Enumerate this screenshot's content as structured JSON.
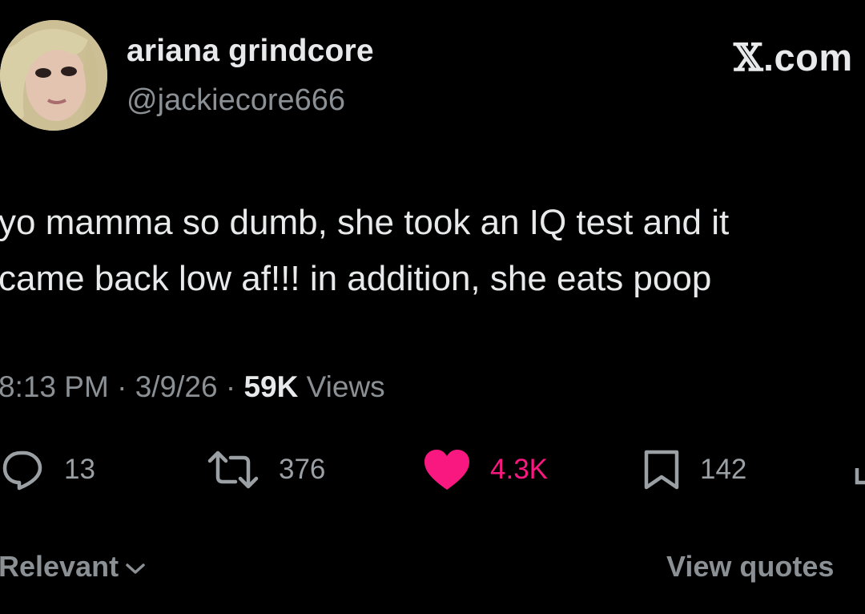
{
  "author": {
    "display_name": "ariana grindcore",
    "handle": "@jackiecore666"
  },
  "brand": {
    "logo_text": ".com",
    "logo_glyph": "𝕏"
  },
  "tweet": {
    "line1": "yo mamma so dumb, she took an IQ test and it",
    "line2": "came back low af!!! in addition, she eats poop"
  },
  "meta": {
    "time": "8:13 PM",
    "sep1": " · ",
    "date": "3/9/26",
    "sep2": " · ",
    "views_count": "59K",
    "views_label": " Views"
  },
  "actions": {
    "replies": {
      "icon": "reply-icon",
      "count": "13"
    },
    "reposts": {
      "icon": "repost-icon",
      "count": "376"
    },
    "likes": {
      "icon": "heart-icon",
      "count": "4.3K",
      "color": "#f91880"
    },
    "bookmarks": {
      "icon": "bookmark-icon",
      "count": "142"
    }
  },
  "footer": {
    "sort_label": "Relevant",
    "view_quotes": "View quotes"
  }
}
